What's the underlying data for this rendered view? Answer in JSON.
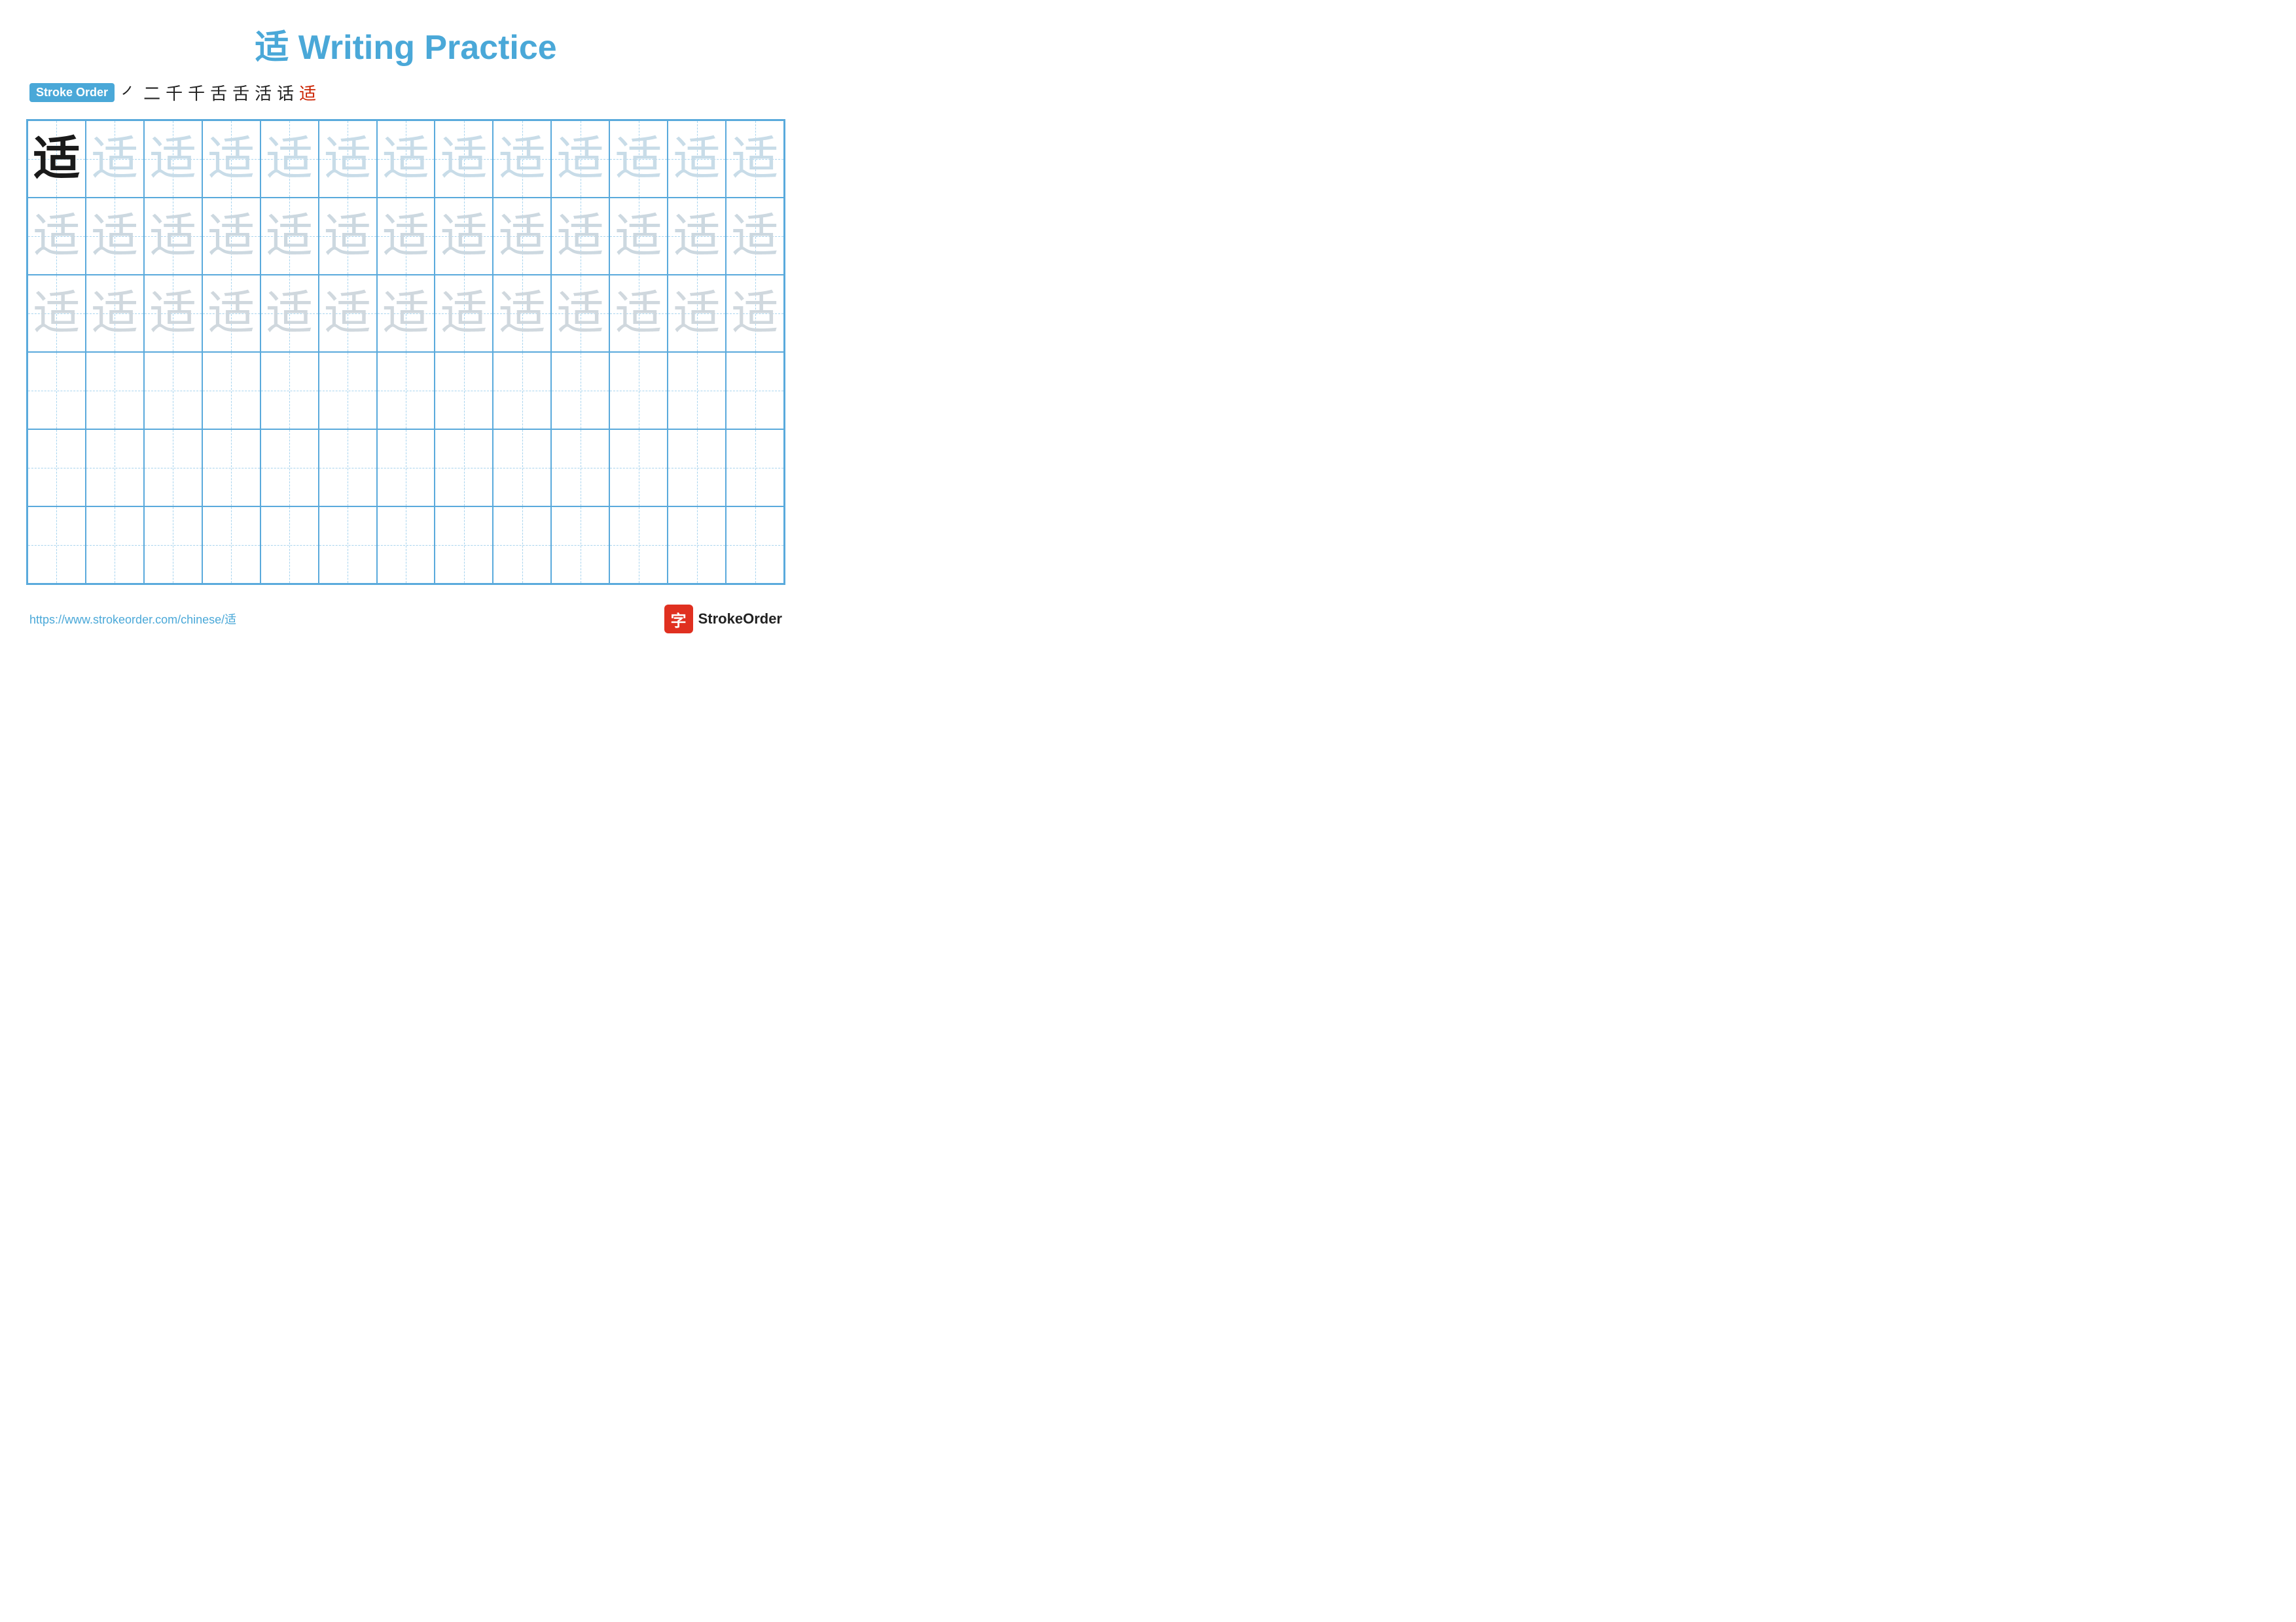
{
  "title": {
    "char": "适",
    "label": "Writing Practice",
    "full": "适 Writing Practice"
  },
  "stroke_order": {
    "badge": "Stroke Order",
    "strokes": [
      "㇒",
      "二",
      "千",
      "千",
      "舌",
      "舌",
      "活",
      "话",
      "适"
    ]
  },
  "grid": {
    "rows": 6,
    "cols": 13,
    "char": "适",
    "row_styles": [
      "dark",
      "light1",
      "light2",
      "empty",
      "empty",
      "empty"
    ]
  },
  "footer": {
    "url": "https://www.strokeorder.com/chinese/适",
    "brand": "StrokeOrder"
  }
}
